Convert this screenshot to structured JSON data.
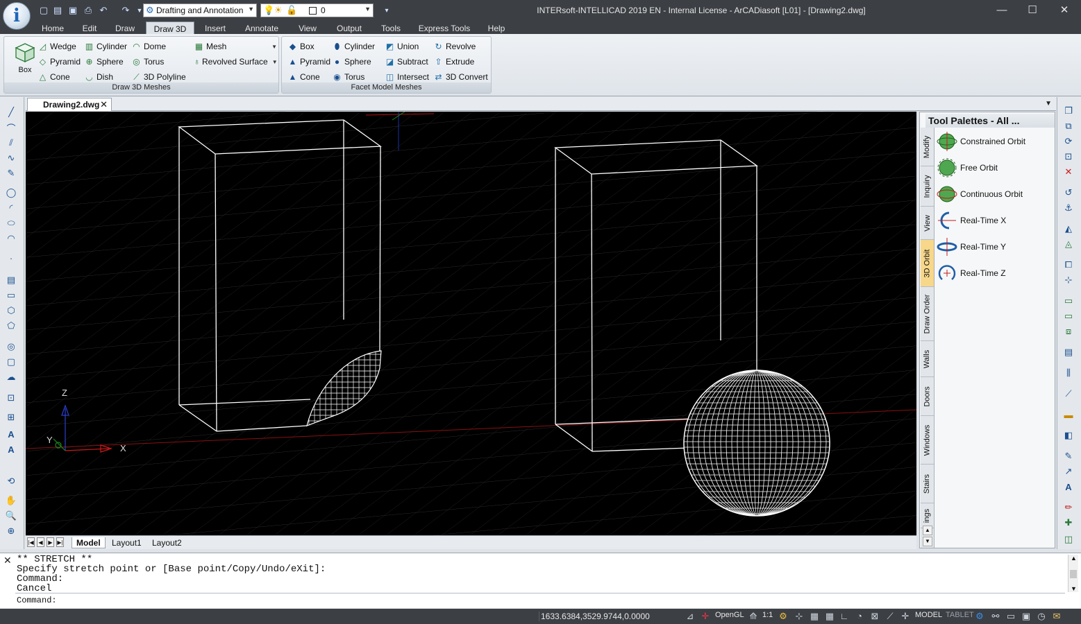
{
  "titlebar": {
    "title": "INTERsoft-INTELLICAD 2019 EN - Internal License - ArCADiasoft [L01] - [Drawing2.dwg]",
    "workspace": "Drafting and Annotation",
    "layer": "0",
    "min_label": "—",
    "max_label": "☐",
    "close_label": "✕"
  },
  "menu": {
    "tabs": [
      "Home",
      "Edit",
      "Draw",
      "Draw 3D",
      "Insert",
      "Annotate",
      "View",
      "Output",
      "Tools",
      "Express Tools",
      "Help"
    ],
    "active": "Draw 3D"
  },
  "ribbon": {
    "panel1_title": "Draw 3D Meshes",
    "panel2_title": "Facet Model Meshes",
    "box": "Box",
    "wedge": "Wedge",
    "pyramid": "Pyramid",
    "cone": "Cone",
    "cylinder": "Cylinder",
    "sphere": "Sphere",
    "dish": "Dish",
    "dome": "Dome",
    "torus": "Torus",
    "polyline3d": "3D Polyline",
    "mesh": "Mesh",
    "revolved_surface": "Revolved Surface",
    "f_box": "Box",
    "f_pyramid": "Pyramid",
    "f_cone": "Cone",
    "f_cylinder": "Cylinder",
    "f_sphere": "Sphere",
    "f_torus": "Torus",
    "union": "Union",
    "subtract": "Subtract",
    "intersect": "Intersect",
    "revolve": "Revolve",
    "extrude": "Extrude",
    "convert3d": "3D Convert"
  },
  "document": {
    "tab": "Drawing2.dwg",
    "close": "✕"
  },
  "ucs": {
    "x": "X",
    "y": "Y",
    "z": "Z"
  },
  "layouts": {
    "tabs": [
      "Model",
      "Layout1",
      "Layout2"
    ],
    "active": "Model"
  },
  "palette": {
    "title": "Tool Palettes - All ...",
    "tabs": [
      "Modify",
      "Inquiry",
      "View",
      "3D Orbit",
      "Draw Order",
      "Walls",
      "Doors",
      "Windows",
      "Stairs",
      "ings"
    ],
    "active_tab": "3D Orbit",
    "items": [
      "Constrained Orbit",
      "Free Orbit",
      "Continuous Orbit",
      "Real-Time X",
      "Real-Time Y",
      "Real-Time Z"
    ]
  },
  "command": {
    "history": [
      "** STRETCH **",
      "Specify stretch point or [Base point/Copy/Undo/eXit]:",
      "Command:",
      "Cancel"
    ],
    "prompt": "Command:"
  },
  "status": {
    "coords": "1633.6384,3529.9744,0.0000",
    "opengl": "OpenGL",
    "scale": "1:1",
    "model": "MODEL",
    "tablet": "TABLET"
  },
  "colors": {
    "chrome": "#3c3f44",
    "viewport": "#000000",
    "accent": "#1f67b8",
    "active_palette_tab": "#f7d78a"
  }
}
